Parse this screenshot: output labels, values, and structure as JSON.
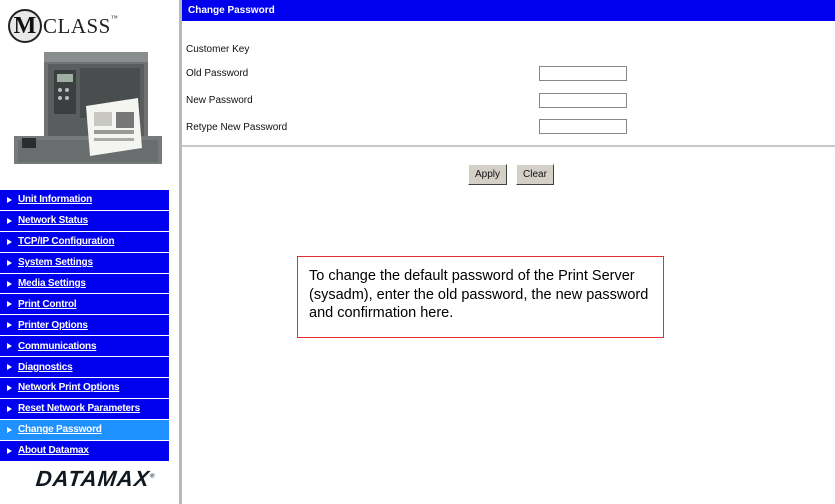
{
  "sidebar": {
    "logo_letter": "M",
    "logo_text": "CLASS",
    "logo_tm": "™",
    "items": [
      {
        "label": "Unit Information",
        "active": false
      },
      {
        "label": "Network Status",
        "active": false
      },
      {
        "label": "TCP/IP Configuration",
        "active": false
      },
      {
        "label": "System Settings",
        "active": false
      },
      {
        "label": "Media Settings",
        "active": false
      },
      {
        "label": "Print Control",
        "active": false
      },
      {
        "label": "Printer Options",
        "active": false
      },
      {
        "label": "Communications",
        "active": false
      },
      {
        "label": "Diagnostics",
        "active": false
      },
      {
        "label": "Network Print Options",
        "active": false
      },
      {
        "label": "Reset Network Parameters",
        "active": false
      },
      {
        "label": "Change Password",
        "active": true
      },
      {
        "label": "About Datamax",
        "active": false
      }
    ],
    "brand": "DATAMAX",
    "brand_tm": "®"
  },
  "main": {
    "title": "Change Password",
    "form": {
      "customer_key_label": "Customer Key",
      "old_password_label": "Old Password",
      "new_password_label": "New Password",
      "retype_password_label": "Retype New Password",
      "old_password_value": "",
      "new_password_value": "",
      "retype_password_value": ""
    },
    "buttons": {
      "apply": "Apply",
      "clear": "Clear"
    },
    "callout": "To change the default password of the Print Server (sysadm), enter the old password, the new password and confirmation here."
  },
  "colors": {
    "nav_blue": "#0000ee",
    "nav_active": "#1e90ff",
    "callout_border": "#e03030"
  }
}
